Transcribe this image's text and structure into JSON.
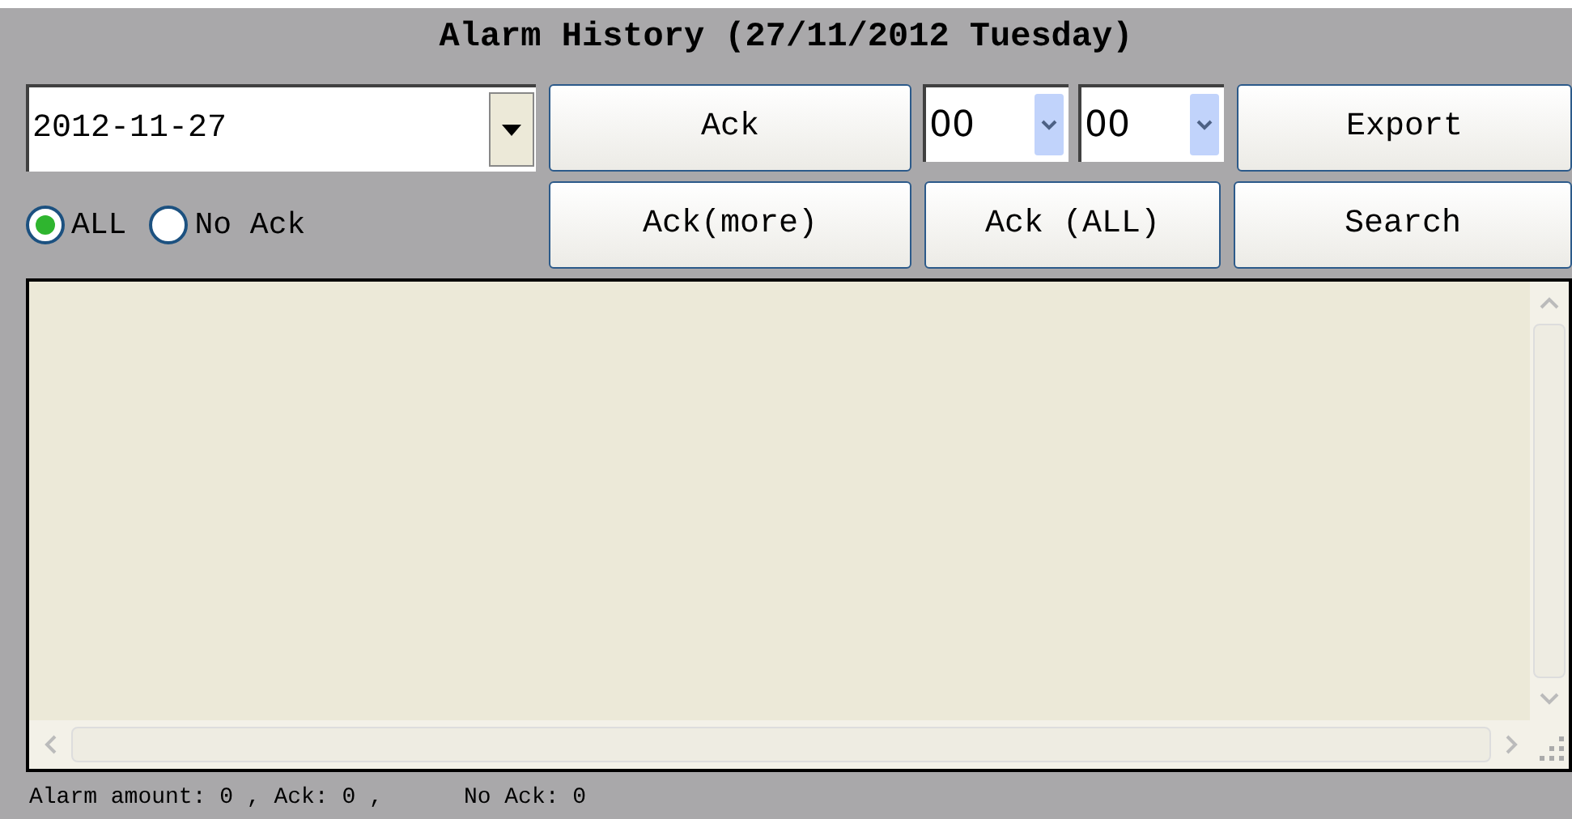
{
  "title": "Alarm History (27/11/2012 Tuesday)",
  "date_field": {
    "value": "2012-11-27"
  },
  "ack_button": "Ack",
  "time_selects": [
    {
      "value": "00"
    },
    {
      "value": "00"
    }
  ],
  "export_button": "Export",
  "filter_radios": [
    {
      "label": "ALL",
      "selected": true
    },
    {
      "label": "No Ack",
      "selected": false
    }
  ],
  "row_2_buttons": [
    "Ack(more)",
    "Ack (ALL)",
    "Search"
  ],
  "status_bar": [
    "Alarm amount: 0 , Ack: 0 ,",
    "No Ack: 0"
  ]
}
